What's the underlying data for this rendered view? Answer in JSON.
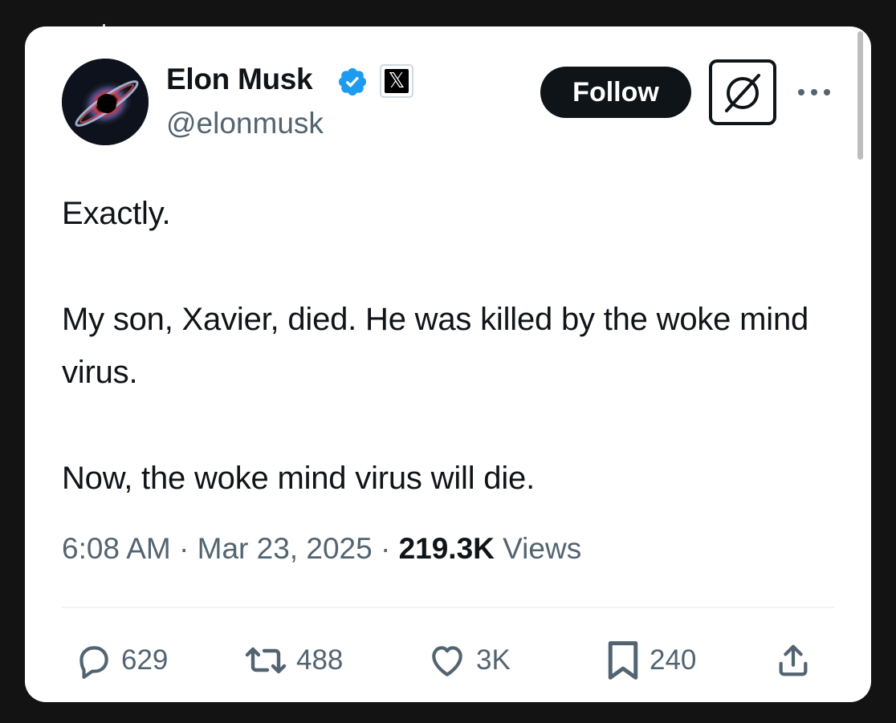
{
  "tweet": {
    "author": {
      "name": "Elon Musk",
      "handle": "@elonmusk",
      "verified_icon": "verified-badge-icon",
      "affiliation_icon": "x-logo-icon"
    },
    "header_actions": {
      "follow_label": "Follow",
      "grok_icon": "grok-icon",
      "more_icon": "more-icon"
    },
    "text": {
      "line1": "Exactly.",
      "line2": "My son, Xavier, died. He was killed by the woke mind virus.",
      "line3": "Now, the woke mind virus will die."
    },
    "meta": {
      "time": "6:08 AM",
      "separator1": " · ",
      "date": "Mar 23, 2025",
      "separator2": " · ",
      "views_count": "219.3K",
      "views_label": " Views"
    },
    "actions": {
      "replies": "629",
      "reposts": "488",
      "likes": "3K",
      "bookmarks": "240"
    }
  },
  "colors": {
    "text_primary": "#0f1419",
    "text_secondary": "#536471",
    "verified_blue": "#1d9bf0",
    "background": "#131313",
    "card": "#ffffff"
  }
}
